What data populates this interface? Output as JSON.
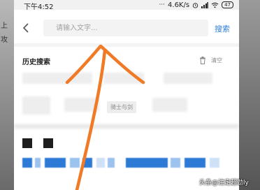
{
  "statusbar": {
    "time": "下午4:52",
    "signal_dots": "···",
    "network_speed": "4.6K/s",
    "battery": "47"
  },
  "background": {
    "left_text_1": "上",
    "left_text_2": "攻"
  },
  "search": {
    "placeholder": "请输入文字...",
    "button_label": "搜索",
    "back_icon": "chevron-left-icon"
  },
  "history": {
    "title": "历史搜索",
    "clear_label": "清空",
    "trash_icon": "trash-icon",
    "visible_chip": "骑士与剑"
  },
  "watermark": "头条@注定超劲ly",
  "annotation_color": "#f07a26",
  "accent_color": "#2f7fd6"
}
